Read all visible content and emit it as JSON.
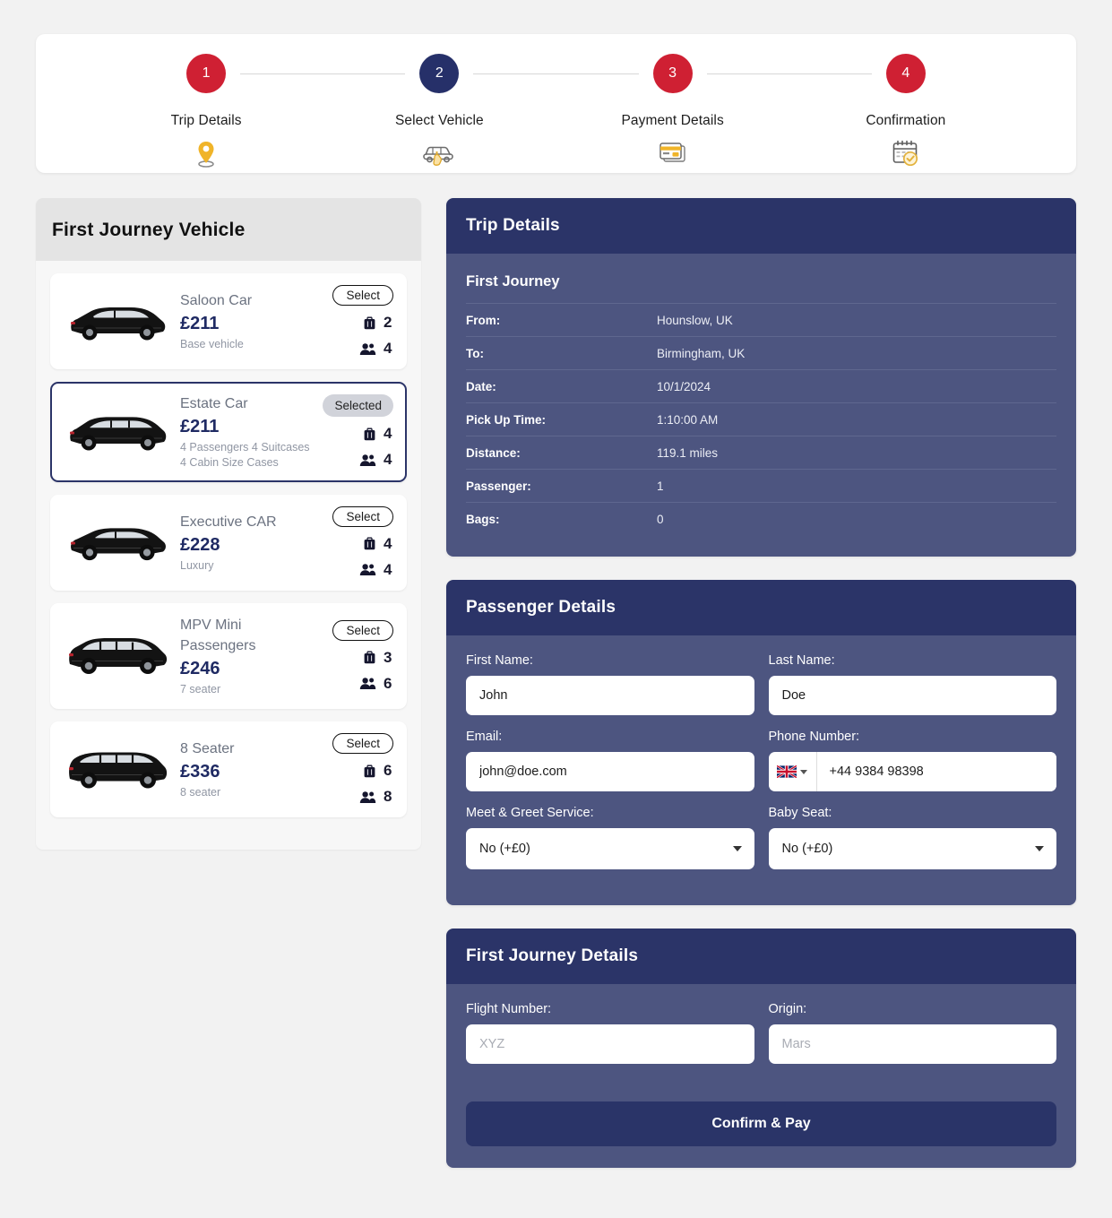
{
  "stepper": {
    "steps": [
      {
        "number": "1",
        "label": "Trip Details",
        "icon": "map-pin-icon",
        "state": "red"
      },
      {
        "number": "2",
        "label": "Select Vehicle",
        "icon": "car-select-hand-icon",
        "state": "navy"
      },
      {
        "number": "3",
        "label": "Payment Details",
        "icon": "credit-card-icon",
        "state": "red"
      },
      {
        "number": "4",
        "label": "Confirmation",
        "icon": "calendar-check-icon",
        "state": "red"
      }
    ]
  },
  "colors": {
    "accent_red": "#cf2033",
    "accent_navy": "#263069",
    "panel_header": "#2b3468",
    "panel_body": "#4d5580",
    "price": "#1f2a63",
    "page_bg": "#f2f2f2"
  },
  "vehicle_panel": {
    "title": "First Journey Vehicle",
    "select_label": "Select",
    "selected_label": "Selected",
    "vehicles": [
      {
        "name": "Saloon Car",
        "price": "£211",
        "description": "Base vehicle",
        "bags": "2",
        "passengers": "4",
        "selected": false,
        "image": "saloon-car-image"
      },
      {
        "name": "Estate Car",
        "price": "£211",
        "description": "4 Passengers 4 Suitcases\n4 Cabin Size Cases",
        "bags": "4",
        "passengers": "4",
        "selected": true,
        "image": "estate-car-image"
      },
      {
        "name": "Executive CAR",
        "price": "£228",
        "description": "Luxury",
        "bags": "4",
        "passengers": "4",
        "selected": false,
        "image": "executive-car-image"
      },
      {
        "name": "MPV Mini Passengers",
        "price": "£246",
        "description": "7 seater",
        "bags": "3",
        "passengers": "6",
        "selected": false,
        "image": "mpv-image"
      },
      {
        "name": "8 Seater",
        "price": "£336",
        "description": "8 seater",
        "bags": "6",
        "passengers": "8",
        "selected": false,
        "image": "eight-seater-van-image"
      }
    ]
  },
  "trip_details": {
    "title": "Trip Details",
    "journey_title": "First Journey",
    "rows": [
      {
        "key": "From:",
        "value": "Hounslow, UK"
      },
      {
        "key": "To:",
        "value": "Birmingham, UK"
      },
      {
        "key": "Date:",
        "value": "10/1/2024"
      },
      {
        "key": "Pick Up Time:",
        "value": "1:10:00 AM"
      },
      {
        "key": "Distance:",
        "value": "119.1 miles"
      },
      {
        "key": "Passenger:",
        "value": "1"
      },
      {
        "key": "Bags:",
        "value": "0"
      }
    ]
  },
  "passenger_details": {
    "title": "Passenger Details",
    "first_name": {
      "label": "First Name:",
      "value": "John",
      "placeholder": ""
    },
    "last_name": {
      "label": "Last Name:",
      "value": "Doe",
      "placeholder": ""
    },
    "email": {
      "label": "Email:",
      "value": "john@doe.com",
      "placeholder": ""
    },
    "phone": {
      "label": "Phone Number:",
      "value": "+44 9384 98398",
      "placeholder": "",
      "country_flag": "uk-flag-icon"
    },
    "meet_greet": {
      "label": "Meet & Greet Service:",
      "value": "No (+£0)"
    },
    "baby_seat": {
      "label": "Baby Seat:",
      "value": "No (+£0)"
    }
  },
  "journey_details": {
    "title": "First Journey Details",
    "flight_number": {
      "label": "Flight Number:",
      "value": "",
      "placeholder": "XYZ"
    },
    "origin": {
      "label": "Origin:",
      "value": "",
      "placeholder": "Mars"
    },
    "confirm_button": "Confirm & Pay"
  }
}
